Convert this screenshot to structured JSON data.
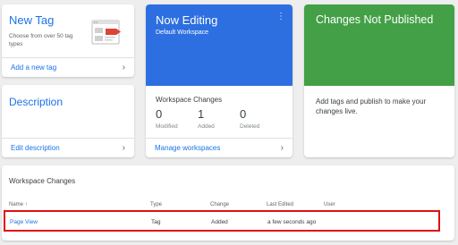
{
  "new_tag": {
    "title": "New Tag",
    "subtitle": "Choose from over 50 tag types",
    "link": "Add a new tag"
  },
  "description": {
    "title": "Description",
    "link": "Edit description"
  },
  "now_editing": {
    "title": "Now Editing",
    "workspace": "Default Workspace",
    "menu_icon": "⋮",
    "changes_label": "Workspace Changes",
    "stats": [
      {
        "value": "0",
        "label": "Modified"
      },
      {
        "value": "1",
        "label": "Added"
      },
      {
        "value": "0",
        "label": "Deleted"
      }
    ],
    "link": "Manage workspaces"
  },
  "changes_not_published": {
    "title": "Changes Not Published",
    "text": "Add tags and publish to make your changes live."
  },
  "table": {
    "title": "Workspace Changes",
    "headers": {
      "name": "Name ↑",
      "type": "Type",
      "change": "Change",
      "last_edited": "Last Edited",
      "user": "User"
    },
    "rows": [
      {
        "name": "Page View",
        "type": "Tag",
        "change": "Added",
        "last_edited": "a few seconds ago",
        "user": ""
      }
    ]
  },
  "chevron": "›",
  "colors": {
    "link": "#1a73e8",
    "editing_bg": "#2d6fe0",
    "changes_bg": "#43a047",
    "highlight": "#e01010"
  }
}
